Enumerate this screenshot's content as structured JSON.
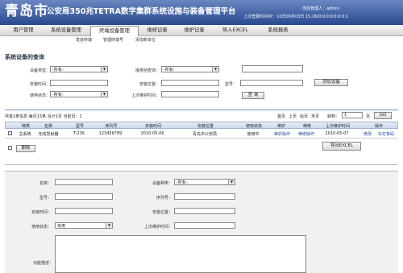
{
  "header": {
    "city": "青岛市",
    "app_title": "公安局350兆TETRA数字集群系统设施与装备管理平台",
    "admin_text": "当前管理人：admin",
    "last_login": "上次登录时间/IP：10年09月03日 15:26/0:0:0:0:0:0:0:1"
  },
  "nav": {
    "tabs": [
      "用户管理",
      "系统设备管理",
      "终端设备管理",
      "维修记录",
      "维护记录",
      "导入EXCEL",
      "系统报表"
    ],
    "active": "终端设备管理",
    "sub": [
      "发放终端",
      "管理终端号",
      "添加新单位"
    ]
  },
  "query": {
    "title": "系统设备的查询",
    "device_type_label": "设备类型：",
    "device_type_value": "-所有-",
    "access_base_label": "接类别查询：",
    "access_base_value": "-所有-",
    "install_time_label": "安装时间：",
    "install_location_label": "安装位置：",
    "model_label": "型号：",
    "use_status_label": "使用状态：",
    "use_status_value": "-所有-",
    "last_maint_label": "上次维护时间：",
    "add_button": "添加设备",
    "query_button": "查 询"
  },
  "results": {
    "summary": "共有1条信息  每页15条  合计1页  当前页：1",
    "first": "首页",
    "prev": "上页",
    "next": "后页",
    "last": "末页",
    "goto_label": "转到：",
    "goto_value": "1",
    "page_label": "页",
    "go": "GO",
    "columns": [
      "种类",
      "名称",
      "型号",
      "序列号",
      "安装时间",
      "安装位置",
      "使用状态",
      "维护",
      "维修",
      "上次维护时间",
      "操作"
    ],
    "rows": [
      {
        "type": "主系统",
        "name": "无线发射器",
        "model": "T-236",
        "serial": "123456789",
        "install_time": "2010-05-06",
        "location": "青岛市公安局",
        "status": "使用中",
        "maint": "维护操作",
        "repair": "维修操作",
        "last_maint": "2010-05-07",
        "edit": "修改",
        "extra": "补打条码"
      }
    ],
    "delete": "删除",
    "export": "导出EXCEL"
  },
  "form": {
    "name_label": "名称：",
    "model_label": "型号：",
    "install_time_label": "安装时间：",
    "use_status_label": "使用状态：",
    "use_status_value": "未用",
    "category_label": "设备种类：",
    "category_value": "-所有-",
    "serial_label": "序列号：",
    "install_location_label": "安装位置：",
    "last_maint_label": "上次维护时间：",
    "description_label": "功能描述："
  }
}
